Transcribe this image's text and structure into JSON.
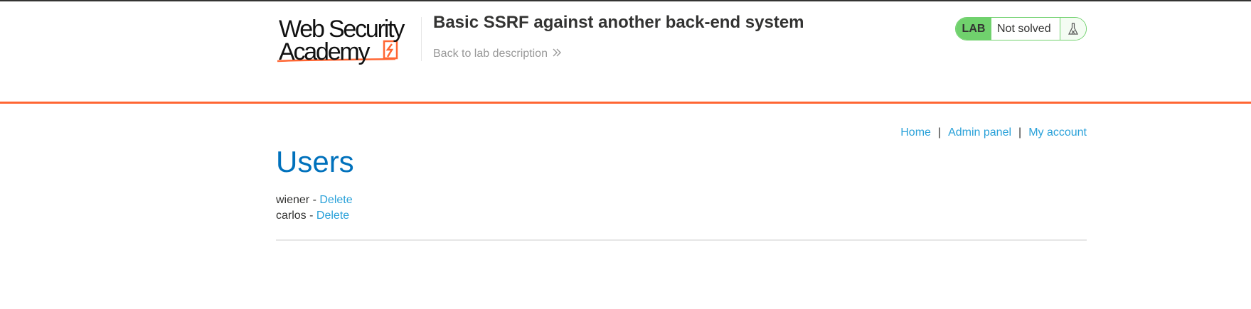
{
  "logo": {
    "line1": "Web Security",
    "line2": "Academy",
    "accent_color": "#ff6633"
  },
  "header": {
    "lab_title": "Basic SSRF against another back-end system",
    "back_link_label": "Back to lab description"
  },
  "status": {
    "tag": "LAB",
    "text": "Not solved",
    "icon": "flask-icon",
    "color": "#70d16d"
  },
  "nav": {
    "home": "Home",
    "admin_panel": "Admin panel",
    "my_account": "My account",
    "separator": "|"
  },
  "main": {
    "title": "Users",
    "users": [
      {
        "name": "wiener",
        "separator": " - ",
        "action": "Delete"
      },
      {
        "name": "carlos",
        "separator": " - ",
        "action": "Delete"
      }
    ]
  },
  "colors": {
    "link": "#29a1d9",
    "title": "#0071bc",
    "orange_rule": "#ff6633"
  }
}
